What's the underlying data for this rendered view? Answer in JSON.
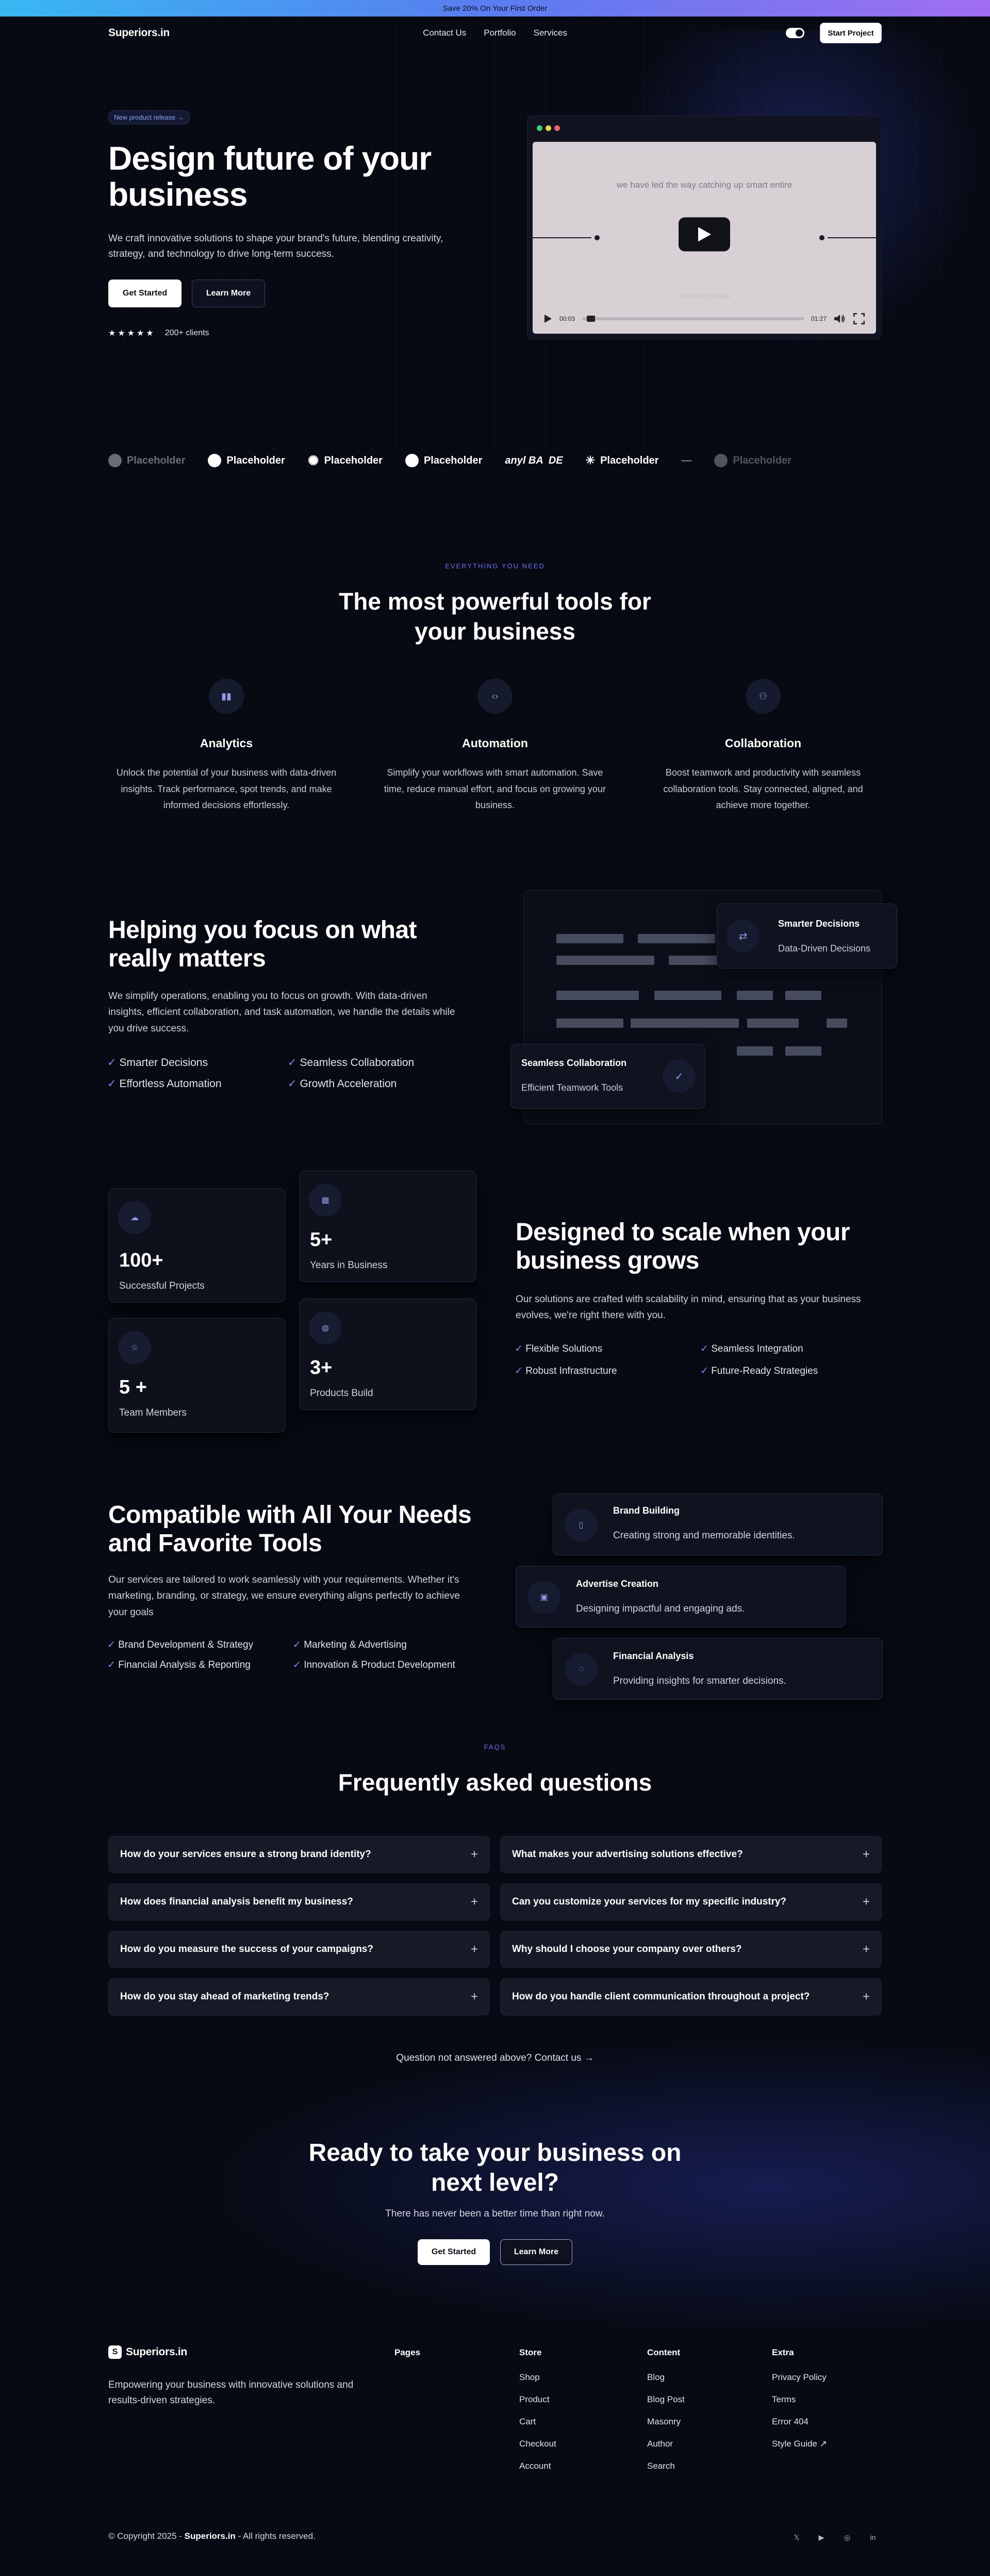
{
  "promo": {
    "text": "Save 20% On Your First Order"
  },
  "nav": {
    "logo": "Superiors.in",
    "links": [
      "Contact Us",
      "Portfolio",
      "Services"
    ],
    "cta": "Start Project"
  },
  "hero": {
    "badge": "New product release →",
    "title": "Design future of your business",
    "description": "We craft innovative solutions to shape your brand's future, blending creativity, strategy, and technology to drive long-term success.",
    "primary_button": "Get Started",
    "secondary_button": "Learn More",
    "stars": "★★★★★",
    "clients": "200+ clients"
  },
  "video": {
    "caption": "we have led the way catching up smart entire",
    "subcaption": "VISION DECADE",
    "time_current": "00:03",
    "time_total": "01:27",
    "progress": 0.02
  },
  "logos": [
    "Placeholder",
    "Placeholder",
    "Placeholder",
    "Placeholder",
    "anyl BA",
    "DE",
    "Placeholder",
    "—",
    "Placeholder"
  ],
  "tools": {
    "eyebrow": "EVERYTHING YOU NEED",
    "title": "The most powerful tools for your business",
    "features": [
      {
        "icon": "bar-chart-icon",
        "title": "Analytics",
        "text": "Unlock the potential of your business with data-driven insights. Track performance, spot trends, and make informed decisions effortlessly."
      },
      {
        "icon": "code-icon",
        "title": "Automation",
        "text": "Simplify your workflows with smart automation. Save time, reduce manual effort, and focus on growing your business."
      },
      {
        "icon": "people-icon",
        "title": "Collaboration",
        "text": "Boost teamwork and productivity with seamless collaboration tools. Stay connected, aligned, and achieve more together."
      }
    ]
  },
  "focus": {
    "title": "Helping you focus on what really matters",
    "description": "We simplify operations, enabling you to focus on growth. With data-driven insights, efficient collaboration, and task automation, we handle the details while you drive success.",
    "checks": [
      "Smarter Decisions",
      "Seamless Collaboration",
      "Effortless Automation",
      "Growth Acceleration"
    ],
    "card1": {
      "title": "Smarter Decisions",
      "subtitle": "Data-Driven Decisions"
    },
    "card2": {
      "title": "Seamless Collaboration",
      "subtitle": "Efficient Teamwork Tools"
    }
  },
  "stats": [
    {
      "value": "100+",
      "label": "Successful Projects",
      "icon": "cloud-icon"
    },
    {
      "value": "5+",
      "label": "Years in Business",
      "icon": "calendar-icon"
    },
    {
      "value": "5 +",
      "label": "Team Members",
      "icon": "star-icon"
    },
    {
      "value": "3+",
      "label": "Products Build",
      "icon": "globe-icon"
    }
  ],
  "scale": {
    "title": "Designed to scale when your business grows",
    "description": "Our solutions are crafted with scalability in mind, ensuring that as your business evolves, we're right there with you.",
    "checks": [
      "Flexible Solutions",
      "Seamless Integration",
      "Robust Infrastructure",
      "Future-Ready Strategies"
    ]
  },
  "compat": {
    "title": "Compatible with All Your Needs and Favorite Tools",
    "description": "Our services are tailored to work seamlessly with your requirements. Whether it's marketing, branding, or strategy, we ensure everything aligns perfectly to achieve your goals",
    "checks": [
      "Brand Development & Strategy",
      "Marketing & Advertising",
      "Financial Analysis & Reporting",
      "Innovation & Product Development"
    ],
    "cards": [
      {
        "title": "Brand Building",
        "subtitle": "Creating strong and memorable identities.",
        "icon": "phone-icon"
      },
      {
        "title": "Advertise Creation",
        "subtitle": "Designing impactful and engaging ads.",
        "icon": "ad-icon"
      },
      {
        "title": "Financial Analysis",
        "subtitle": "Providing insights for smarter decisions.",
        "icon": "spinner-icon"
      }
    ]
  },
  "faq": {
    "eyebrow": "FAQS",
    "title": "Frequently asked questions",
    "items": [
      "How do your services ensure a strong brand identity?",
      "What makes your advertising solutions effective?",
      "How does financial analysis benefit my business?",
      "Can you customize your services for my specific industry?",
      "How do you measure the success of your campaigns?",
      "Why should I choose your company over others?",
      "How do you stay ahead of marketing trends?",
      "How do you handle client communication throughout a project?"
    ],
    "contact": "Question not answered above? Contact us →"
  },
  "cta": {
    "title": "Ready to take your business on next level?",
    "subtitle": "There has never been a better time than right now.",
    "primary_button": "Get Started",
    "secondary_button": "Learn More"
  },
  "footer": {
    "logo": "Superiors.in",
    "tagline": "Empowering your business with innovative solutions and results-driven strategies.",
    "columns": [
      {
        "title": "Pages",
        "links": []
      },
      {
        "title": "Store",
        "links": [
          "Shop",
          "Product",
          "Cart",
          "Checkout",
          "Account"
        ]
      },
      {
        "title": "Content",
        "links": [
          "Blog",
          "Blog Post",
          "Masonry",
          "Author",
          "Search"
        ]
      },
      {
        "title": "Extra",
        "links": [
          "Privacy Policy",
          "Terms",
          "Error 404",
          "Style Guide ↗"
        ]
      }
    ],
    "copyright_prefix": "© Copyright 2025 - ",
    "copyright_brand": "Superiors.in",
    "copyright_suffix": " - All rights reserved.",
    "social": [
      "twitter-icon",
      "youtube-icon",
      "instagram-icon",
      "linkedin-icon"
    ]
  }
}
